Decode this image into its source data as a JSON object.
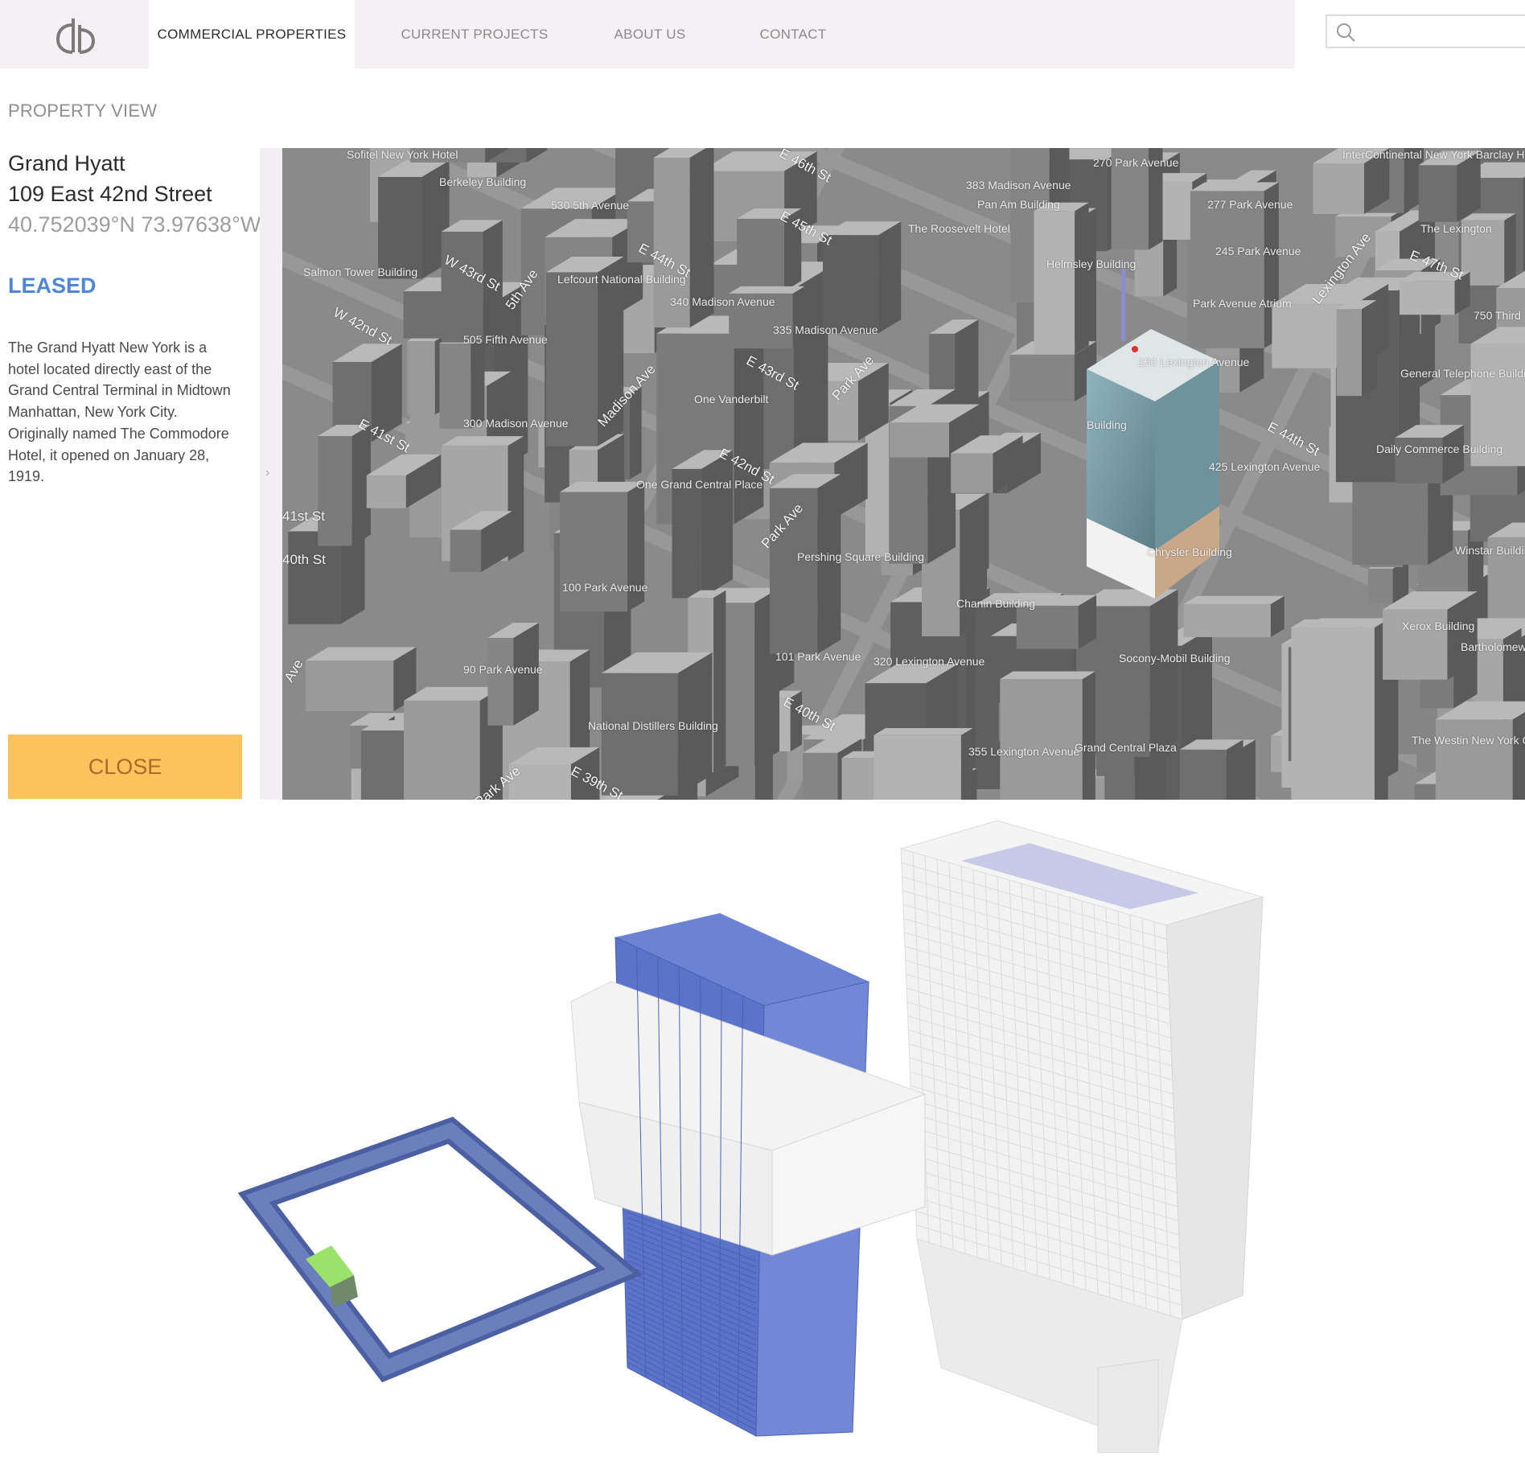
{
  "nav": {
    "logo_icon": "brand-logo-icon",
    "tabs": [
      {
        "label": "COMMERCIAL PROPERTIES",
        "active": true
      },
      {
        "label": "CURRENT PROJECTS",
        "active": false
      },
      {
        "label": "ABOUT US",
        "active": false
      },
      {
        "label": "CONTACT",
        "active": false
      }
    ],
    "search": {
      "placeholder": "",
      "value": "",
      "icon": "search-icon"
    }
  },
  "property": {
    "section_title": "PROPERTY VIEW",
    "name": "Grand Hyatt",
    "address": "109 East 42nd Street",
    "coordinates": "40.752039°N 73.97638°W",
    "status": "LEASED",
    "description": "The Grand Hyatt New York is a hotel located directly east of the Grand Central Terminal in Midtown Manhattan, New York City. Originally named The Commodore Hotel, it opened on January 28, 1919.",
    "close_label": "CLOSE"
  },
  "map": {
    "building_labels": [
      "Sofitel New York Hotel",
      "Berkeley Building",
      "530 5th Avenue",
      "383 Madison Avenue",
      "270 Park Avenue",
      "InterContinental New York Barclay Hotel",
      "Pan Am Building",
      "277 Park Avenue",
      "The Roosevelt Hotel",
      "The Lexington",
      "Salmon Tower Building",
      "Lefcourt National Building",
      "340 Madison Avenue",
      "Helmsley Building",
      "245 Park Avenue",
      "Park Avenue Atrium",
      "750 Third",
      "505 Fifth Avenue",
      "335 Madison Avenue",
      "150 Lexington Avenue",
      "General Telephone Building",
      "One Vanderbilt",
      "300 Madison Avenue",
      "Daily Commerce Building",
      "425 Lexington Avenue",
      "One Grand Central Place",
      "Winstar Building",
      "Pershing Square Building",
      "Chrysler Building",
      "100 Park Avenue",
      "Chanin Building",
      "Xerox Building",
      "Bartholomew Building",
      "90 Park Avenue",
      "101 Park Avenue",
      "320 Lexington Avenue",
      "Socony-Mobil Building",
      "National Distillers Building",
      "355 Lexington Avenue",
      "Grand Central Plaza",
      "The Westin New York Grand Central Hotel",
      "Building"
    ],
    "street_labels": [
      "E 46th St",
      "E 45th St",
      "E 44th St",
      "W 43rd St",
      "W 42nd St",
      "E 43rd St",
      "E 42nd St",
      "E 41st St",
      "5th Ave",
      "Madison Ave",
      "Park Ave",
      "Park Ave",
      "Lexington Ave",
      "E 47th St",
      "E 44th St",
      "E 40th St",
      "E 39th St",
      "Park Ave",
      "41st St",
      "40th St",
      "Ave"
    ]
  },
  "colors": {
    "nav_bg": "#f4f0f4",
    "status_blue": "#4f86d8",
    "close_button": "#fcc25b",
    "close_text": "#a96a2b",
    "model_blue": "#5b73c8",
    "model_green": "#9be26a",
    "model_white": "#f0f0f0"
  }
}
